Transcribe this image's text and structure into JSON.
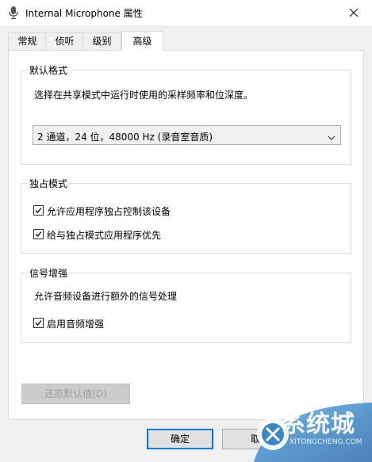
{
  "window": {
    "title": "Internal Microphone 属性"
  },
  "tabs": [
    {
      "label": "常规"
    },
    {
      "label": "侦听"
    },
    {
      "label": "级别"
    },
    {
      "label": "高级"
    }
  ],
  "default_format": {
    "title": "默认格式",
    "description": "选择在共享模式中运行时使用的采样频率和位深度。",
    "selected": "2 通道，24 位，48000 Hz (录音室音质)"
  },
  "exclusive_mode": {
    "title": "独占模式",
    "options": [
      {
        "label": "允许应用程序独占控制该设备",
        "checked": true
      },
      {
        "label": "给与独占模式应用程序优先",
        "checked": true
      }
    ]
  },
  "signal_enhancement": {
    "title": "信号增强",
    "description": "允许音频设备进行额外的信号处理",
    "option": {
      "label": "启用音频增强",
      "checked": true
    }
  },
  "buttons": {
    "restore_default": "还原默认值(D)",
    "ok": "确定",
    "cancel": "取"
  },
  "watermark": {
    "text": "系统城",
    "sub": "XITONGCHENG.COM"
  }
}
